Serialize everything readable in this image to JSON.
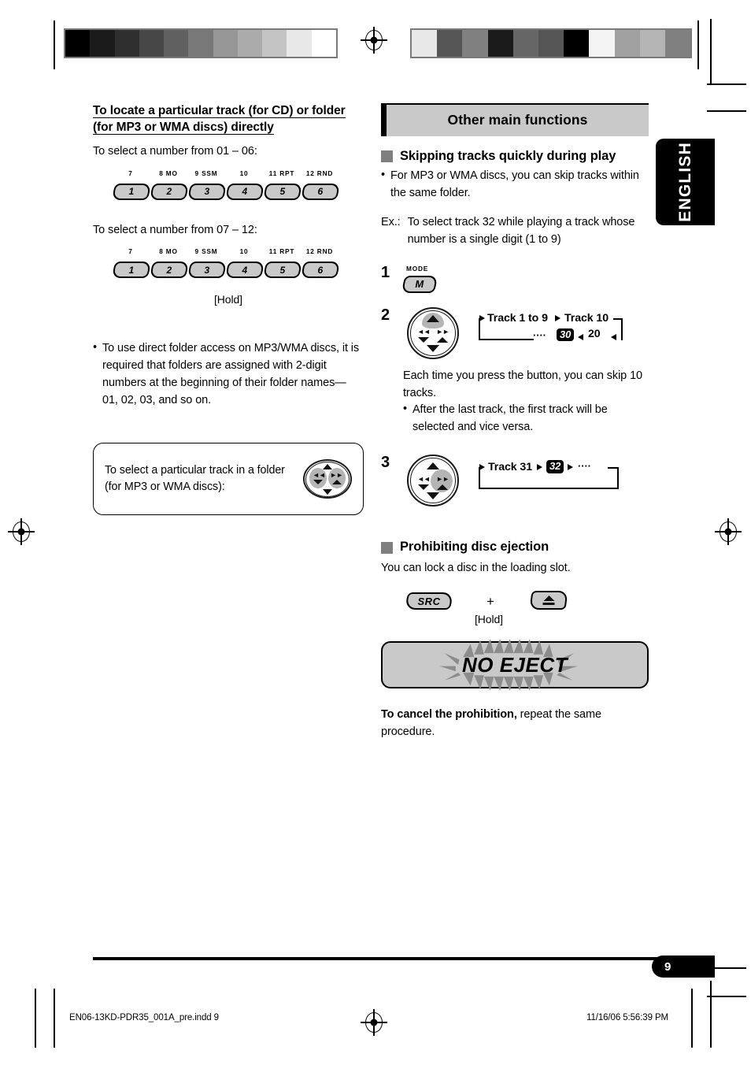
{
  "page": {
    "number": "9",
    "language_tab": "ENGLISH",
    "footer_left": "EN06-13KD-PDR35_001A_pre.indd   9",
    "footer_right": "11/16/06   5:56:39 PM"
  },
  "colors": {
    "accent_gray": "#c9c9c9",
    "marker_gray": "#7f7f7f",
    "highlight_gray": "#b4b4b4",
    "black": "#000000"
  },
  "calibration": {
    "left_strip": [
      "#000000",
      "#1b1b1b",
      "#2f2f2f",
      "#474747",
      "#606060",
      "#787878",
      "#969696",
      "#ababab",
      "#c4c4c4",
      "#e8e8e8",
      "#ffffff"
    ],
    "right_strip": [
      "#e8e8e8",
      "#555555",
      "#808080",
      "#1b1b1b",
      "#666666",
      "#555555",
      "#000000",
      "#f4f4f4",
      "#a0a0a0",
      "#b4b4b4",
      "#808080"
    ]
  },
  "left_column": {
    "heading_line1": "To locate a particular track (for CD) or folder",
    "heading_line2": "(for MP3 or WMA discs) directly",
    "intro_1": "To select a number from 01 – 06:",
    "intro_2": "To select a number from 07 – 12:",
    "hold_label": "[Hold]",
    "preset_buttons": [
      {
        "number": "1",
        "label": "7"
      },
      {
        "number": "2",
        "label": "8  MO"
      },
      {
        "number": "3",
        "label": "9  SSM"
      },
      {
        "number": "4",
        "label": "10"
      },
      {
        "number": "5",
        "label": "11  RPT"
      },
      {
        "number": "6",
        "label": "12  RND"
      }
    ],
    "bullet_folder_access": "To use direct folder access on MP3/WMA discs, it is required that folders are assigned with 2-digit numbers at the beginning of their folder names— 01, 02, 03, and so on.",
    "note_box_line1": "To select a particular track in a folder",
    "note_box_line2": "(for MP3 or WMA discs):"
  },
  "right_column": {
    "banner_title": "Other main functions",
    "section1": {
      "title": "Skipping tracks quickly during play",
      "bullet": "For MP3 or WMA discs, you can skip tracks within the same folder.",
      "example_label": "Ex.:",
      "example_line1": "To select track 32 while playing a track whose",
      "example_line2": "number is a single digit (1 to 9)",
      "step1_no": "1",
      "step1_button_label": "MODE",
      "step1_button_text": "M",
      "step2_no": "2",
      "step2_flow_top_a": "Track 1 to 9",
      "step2_flow_top_b": "Track 10",
      "step2_flow_bottom_dots": "····",
      "step2_flow_chip": "30",
      "step2_flow_bottom_b": "20",
      "step2_note_line1": "Each time you press the button, you can skip 10",
      "step2_note_line2": "tracks.",
      "step2_subbullet": "After the last track, the first track will be selected and vice versa.",
      "step3_no": "3",
      "step3_flow_a": "Track 31",
      "step3_flow_chip": "32",
      "step3_flow_dots": "····"
    },
    "section2": {
      "title": "Prohibiting disc ejection",
      "intro": "You can lock a disc in the loading slot.",
      "src_button": "SRC",
      "plus": "+",
      "hold_label": "[Hold]",
      "display_text": "NO EJECT",
      "cancel_bold": "To cancel the prohibition,",
      "cancel_rest": " repeat the same",
      "cancel_line2": "procedure."
    }
  }
}
